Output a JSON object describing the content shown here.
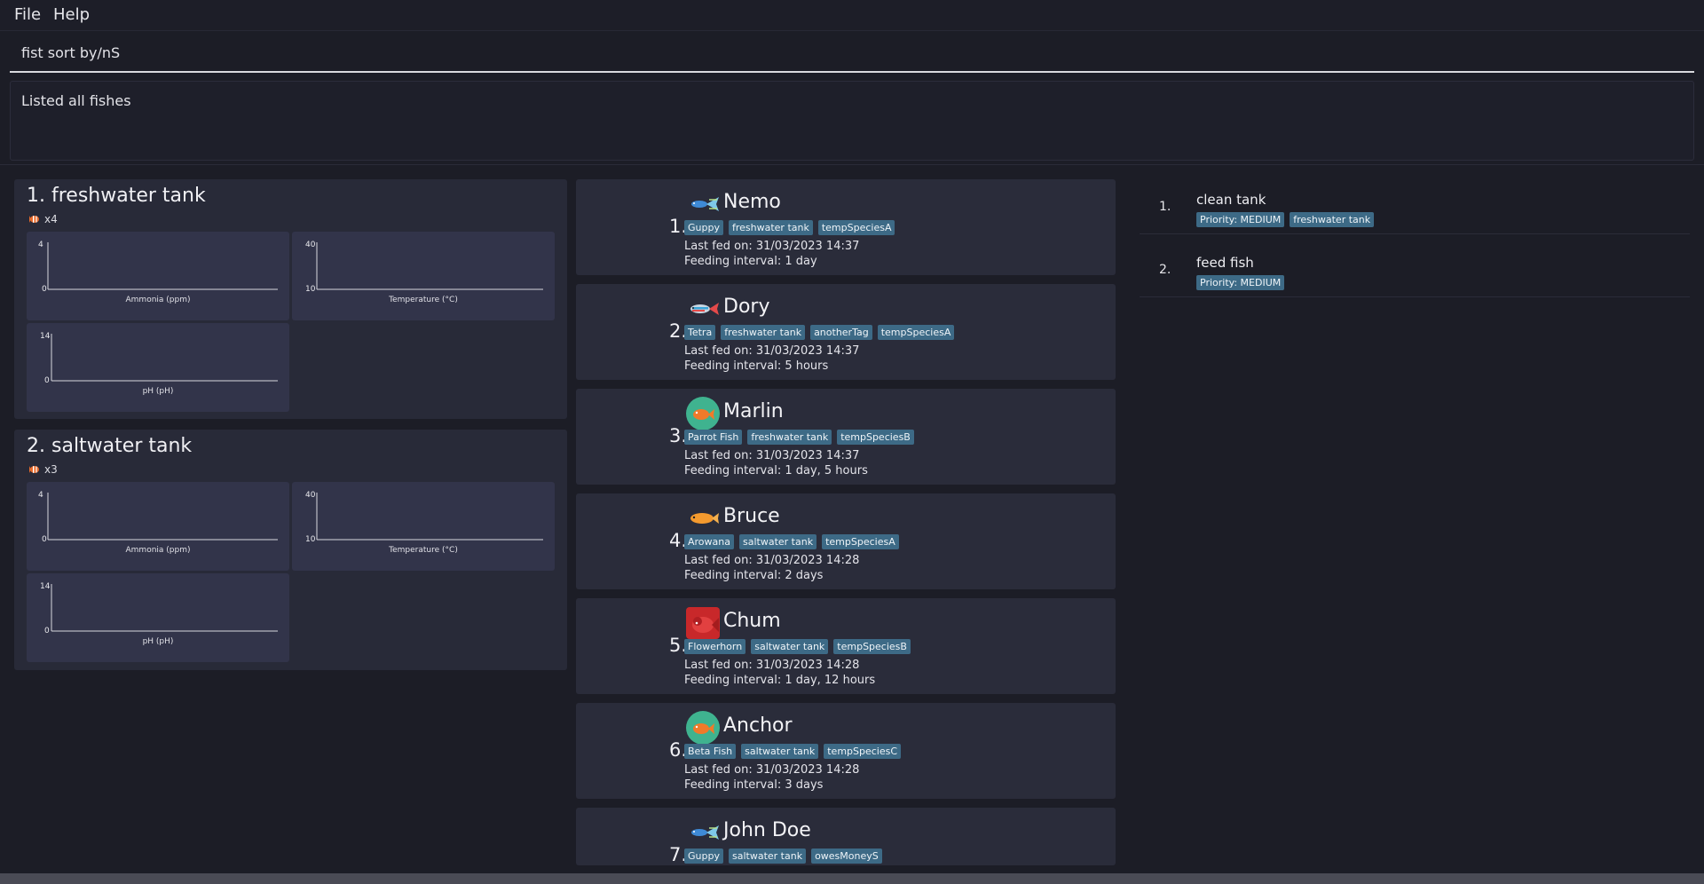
{
  "menu": {
    "file": "File",
    "help": "Help"
  },
  "command": {
    "value": "fist sort by/nS"
  },
  "result": {
    "message": "Listed all fishes"
  },
  "tanks": [
    {
      "index": "1.",
      "name": "freshwater tank",
      "count": "x4",
      "charts": [
        {
          "label": "Ammonia (ppm)",
          "ymax": "4",
          "ymin": "0"
        },
        {
          "label": "Temperature (°C)",
          "ymax": "40",
          "ymin": "10"
        },
        {
          "label": "pH (pH)",
          "ymax": "14",
          "ymin": "0"
        }
      ]
    },
    {
      "index": "2.",
      "name": "saltwater tank",
      "count": "x3",
      "charts": [
        {
          "label": "Ammonia (ppm)",
          "ymax": "4",
          "ymin": "0"
        },
        {
          "label": "Temperature (°C)",
          "ymax": "40",
          "ymin": "10"
        },
        {
          "label": "pH (pH)",
          "ymax": "14",
          "ymin": "0"
        }
      ]
    }
  ],
  "fishes": [
    {
      "index": "1.",
      "name": "Nemo",
      "icon": "guppy-icon",
      "tags": [
        "Guppy",
        "freshwater tank",
        "tempSpeciesA"
      ],
      "last_fed": "Last fed on: 31/03/2023 14:37",
      "interval": "Feeding interval: 1 day"
    },
    {
      "index": "2.",
      "name": "Dory",
      "icon": "tetra-icon",
      "tags": [
        "Tetra",
        "freshwater tank",
        "anotherTag",
        "tempSpeciesA"
      ],
      "last_fed": "Last fed on: 31/03/2023 14:37",
      "interval": "Feeding interval: 5 hours"
    },
    {
      "index": "3.",
      "name": "Marlin",
      "icon": "parrot-fish-icon",
      "tags": [
        "Parrot Fish",
        "freshwater tank",
        "tempSpeciesB"
      ],
      "last_fed": "Last fed on: 31/03/2023 14:37",
      "interval": "Feeding interval: 1 day, 5 hours"
    },
    {
      "index": "4.",
      "name": "Bruce",
      "icon": "arowana-icon",
      "tags": [
        "Arowana",
        "saltwater tank",
        "tempSpeciesA"
      ],
      "last_fed": "Last fed on: 31/03/2023 14:28",
      "interval": "Feeding interval: 2 days"
    },
    {
      "index": "5.",
      "name": "Chum",
      "icon": "flowerhorn-icon",
      "tags": [
        "Flowerhorn",
        "saltwater tank",
        "tempSpeciesB"
      ],
      "last_fed": "Last fed on: 31/03/2023 14:28",
      "interval": "Feeding interval: 1 day, 12 hours"
    },
    {
      "index": "6.",
      "name": "Anchor",
      "icon": "beta-fish-icon",
      "tags": [
        "Beta Fish",
        "saltwater tank",
        "tempSpeciesC"
      ],
      "last_fed": "Last fed on: 31/03/2023 14:28",
      "interval": "Feeding interval: 3 days"
    },
    {
      "index": "7.",
      "name": "John Doe",
      "icon": "guppy-icon",
      "tags": [
        "Guppy",
        "saltwater tank",
        "owesMoneyS"
      ]
    }
  ],
  "tasks": [
    {
      "index": "1.",
      "name": "clean tank",
      "tags": [
        "Priority: MEDIUM",
        "freshwater tank"
      ]
    },
    {
      "index": "2.",
      "name": "feed fish",
      "tags": [
        "Priority: MEDIUM"
      ]
    }
  ],
  "colors": {
    "background": "#1c1d26",
    "card": "#2a2c3a",
    "tag": "#3d6a86",
    "chart": "#32344a"
  }
}
